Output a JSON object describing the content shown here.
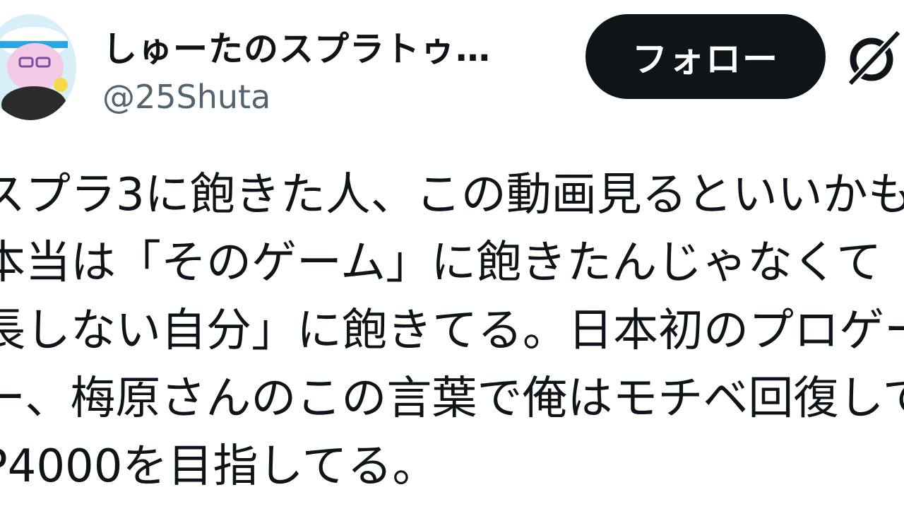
{
  "author": {
    "display_name": "しゅーたのスプラトゥ…",
    "handle": "@25Shuta"
  },
  "actions": {
    "follow_label": "フォロー"
  },
  "icons": {
    "avatar": "avatar",
    "grok": "grok-icon"
  },
  "tweet": {
    "lines": [
      "スプラ3に飽きた人、この動画見るといいかも",
      "本当は「そのゲーム」に飽きたんじゃなくて",
      "長しない自分」に飽きてる。日本初のプロゲー",
      "ー、梅原さんのこの言葉で俺はモチベ回復して",
      "P4000を目指してる。"
    ]
  }
}
